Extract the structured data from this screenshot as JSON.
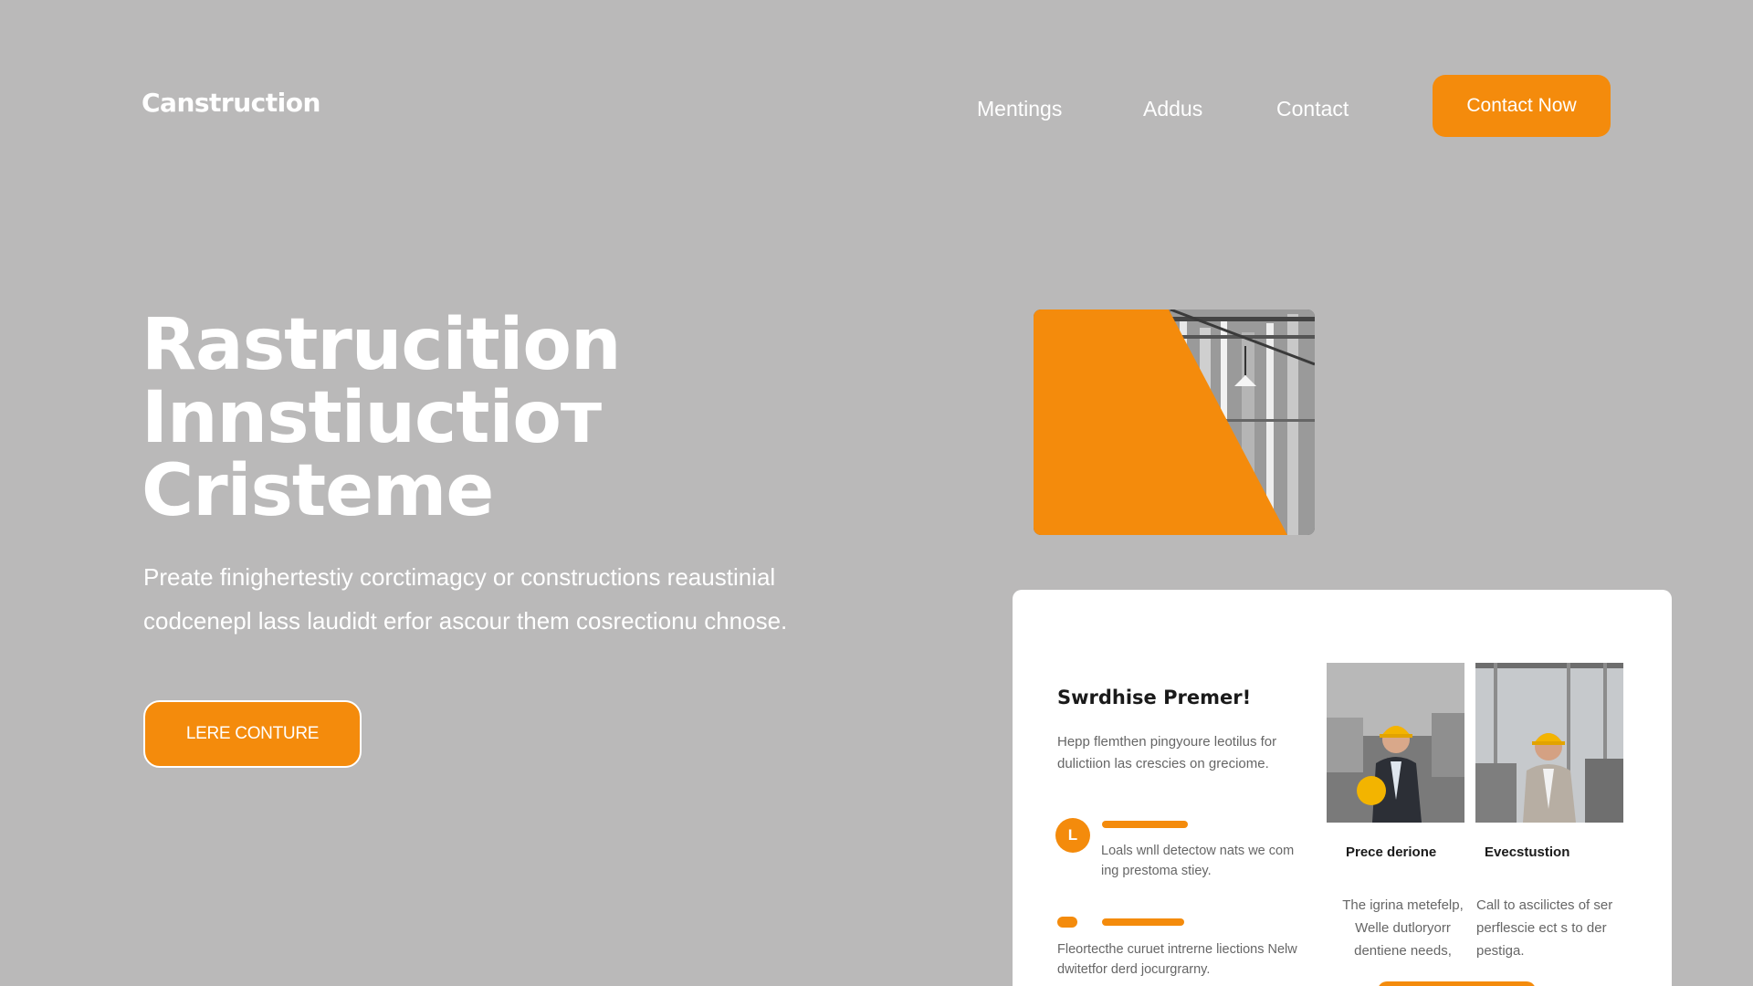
{
  "header": {
    "logo": "Canstruction",
    "nav": [
      "Mentings",
      "Addus",
      "Contact"
    ],
    "cta": "Contact Now"
  },
  "hero": {
    "title_lines": [
      "Rastrucition",
      "Innstiuctioт",
      "Cristeme"
    ],
    "subtitle_lines": [
      "Preate finighertestiy corctimagcy or constructions reaustinial",
      "codcenepl lass laudidt erfor ascour them cosrectionu chnose."
    ],
    "button": "LERE CONTURE"
  },
  "card": {
    "title": "Swrdhise Premer!",
    "description": "Hepp flemthen pingyoure leotilus for dulictiion las crescies on greciome.",
    "items": [
      {
        "badge": "L",
        "text": "Loals wnll detectow nats we com ing prestoma stiey."
      },
      {
        "text": "Fleortecthe curuet intrerne liections Nelw dwitetfor derd jocurgrarny."
      }
    ],
    "people": [
      {
        "label": "Prece derione",
        "text": "The igrina metefelp, Welle dutloryorr dentiene needs,"
      },
      {
        "label": "Evecstustion",
        "text": "Call to ascilictes of ser perflescie ect s to der pestiga."
      }
    ]
  },
  "colors": {
    "background": "#bab9b9",
    "accent": "#f48b0c",
    "card": "#ffffff",
    "text_dark": "#1a1a1a",
    "text_muted": "#666666"
  }
}
